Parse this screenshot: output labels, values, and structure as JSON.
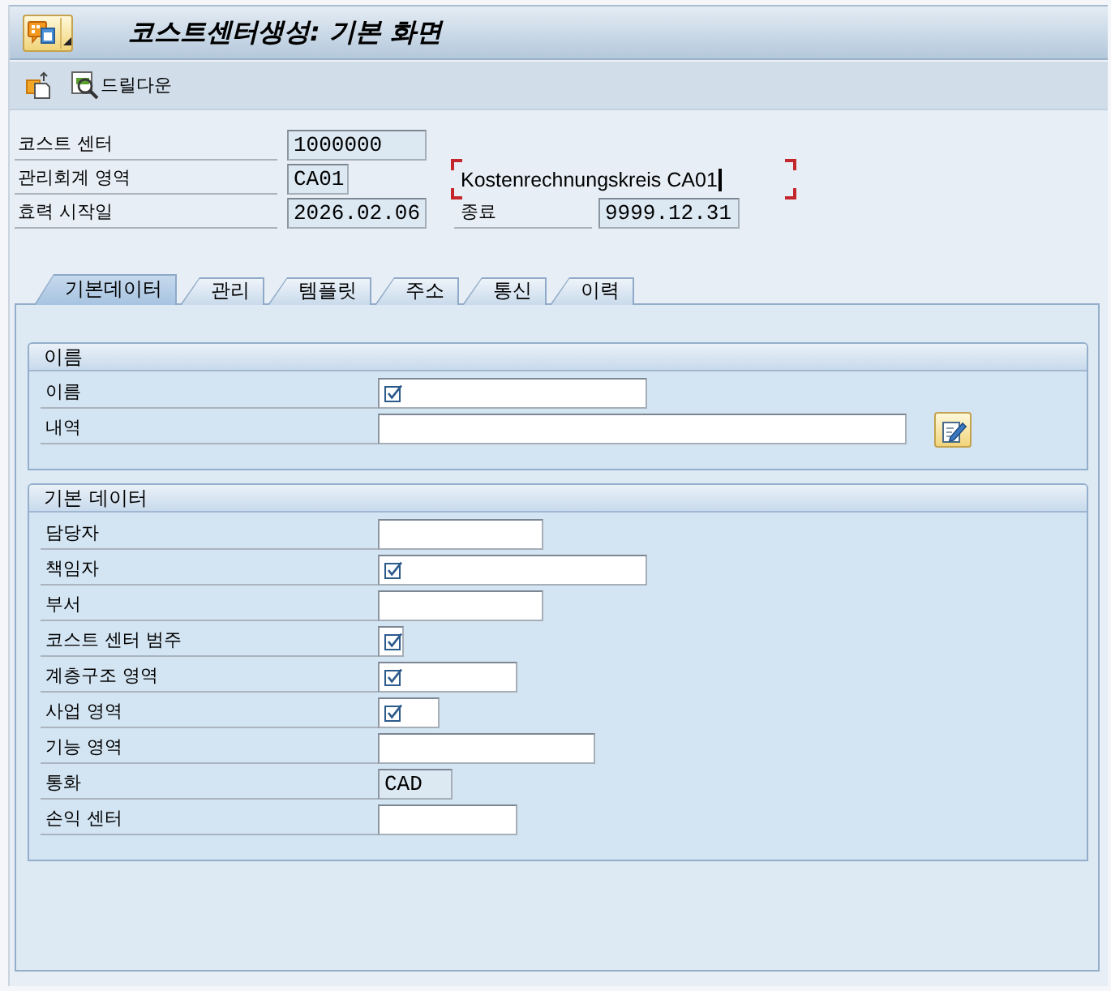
{
  "window": {
    "title": "코스트센터생성: 기본 화면"
  },
  "toolbar": {
    "buttons": [
      {
        "label": "드릴다운"
      }
    ]
  },
  "header": {
    "rows": [
      {
        "label": "코스트 센터",
        "value": "1000000",
        "readonly": true
      },
      {
        "label": "관리회계 영역",
        "value": "CA01",
        "readonly": true,
        "description": {
          "text": "Kostenrechnungskreis CA01",
          "focused": true
        }
      },
      {
        "label": "효력 시작일",
        "value": "2026.02.06",
        "readonly": true,
        "end": {
          "label": "종료",
          "value": "9999.12.31",
          "readonly": true
        }
      }
    ]
  },
  "tabs": [
    {
      "label": "기본데이터",
      "selected": true
    },
    {
      "label": "관리",
      "selected": false
    },
    {
      "label": "템플릿",
      "selected": false
    },
    {
      "label": "주소",
      "selected": false
    },
    {
      "label": "통신",
      "selected": false
    },
    {
      "label": "이력",
      "selected": false
    }
  ],
  "groups": [
    {
      "title": "이름",
      "rows": [
        {
          "kind": "text",
          "label": "이름",
          "required": true,
          "readonly": false
        },
        {
          "kind": "long-text",
          "label": "내역",
          "required": false,
          "readonly": false
        }
      ]
    },
    {
      "title": "기본 데이터",
      "rows": [
        {
          "kind": "text",
          "label": "담당자",
          "required": false,
          "readonly": false
        },
        {
          "kind": "text",
          "label": "책임자",
          "required": true,
          "readonly": false
        },
        {
          "kind": "text",
          "label": "부서",
          "required": false,
          "readonly": false
        },
        {
          "kind": "text",
          "label": "코스트 센터 범주",
          "required": true,
          "readonly": false
        },
        {
          "kind": "text",
          "label": "계층구조 영역",
          "required": true,
          "readonly": false
        },
        {
          "kind": "text",
          "label": "사업 영역",
          "required": true,
          "readonly": false
        },
        {
          "kind": "text",
          "label": "기능 영역",
          "required": false,
          "readonly": false
        },
        {
          "kind": "text",
          "label": "통화",
          "value": "CAD",
          "required": false,
          "readonly": true
        },
        {
          "kind": "text",
          "label": "손익 센터",
          "required": false,
          "readonly": false
        }
      ]
    }
  ]
}
